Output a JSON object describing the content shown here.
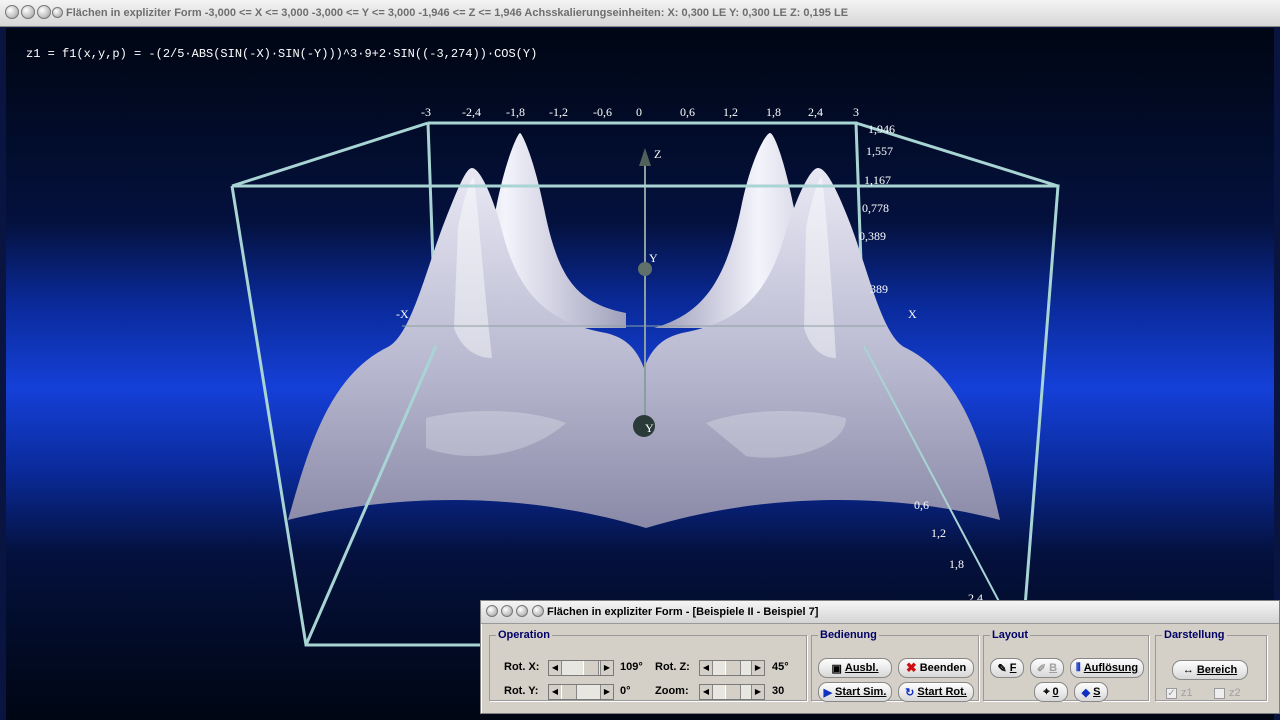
{
  "main_window": {
    "title": "Flächen in expliziter Form   -3,000 <= X <= 3,000   -3,000 <= Y <= 3,000   -1,946 <= Z <= 1,946   Achsskalierungseinheiten:  X: 0,300 LE    Y: 0,300 LE    Z: 0,195 LE"
  },
  "plot": {
    "formula": "z1 = f1(x,y,p) = -(2/5·ABS(SIN(-X)·SIN(-Y)))^3·9+2·SIN((-3,274))·COS(Y)",
    "x_ticks": [
      "-3",
      "-2,4",
      "-1,8",
      "-1,2",
      "-0,6",
      "0",
      "0,6",
      "1,2",
      "1,8",
      "2,4",
      "3"
    ],
    "z_ticks": [
      "1,946",
      "1,557",
      "1,167",
      "0,778",
      "0,389",
      "389"
    ],
    "y_ticks": [
      "0,6",
      "1,2",
      "1,8",
      "2,4"
    ],
    "axis_labels": {
      "z": "Z",
      "y_top": "Y",
      "y_bottom": "Y",
      "x_neg": "-X",
      "x_pos": "X"
    },
    "colors": {
      "surface": "#c4c4da",
      "frame": "#a8d4d4",
      "background": "#1540d8"
    }
  },
  "panel": {
    "title": "Flächen in expliziter Form - [Beispiele II - Beispiel 7]",
    "operation": {
      "legend": "Operation",
      "rot_x_label": "Rot. X:",
      "rot_x_value": "109°",
      "rot_y_label": "Rot. Y:",
      "rot_y_value": "0°",
      "rot_z_label": "Rot. Z:",
      "rot_z_value": "45°",
      "zoom_label": "Zoom:",
      "zoom_value": "30"
    },
    "bedienung": {
      "legend": "Bedienung",
      "ausbl": "Ausbl.",
      "beenden": "Beenden",
      "start_sim": "Start Sim.",
      "start_rot": "Start Rot."
    },
    "layout": {
      "legend": "Layout",
      "f": "F",
      "b": "B",
      "aufloesung": "Auflösung",
      "zero": "0",
      "s": "S"
    },
    "darstellung": {
      "legend": "Darstellung",
      "bereich": "Bereich",
      "z1": "z1",
      "z1_checked": true,
      "z2": "z2",
      "z2_checked": false
    }
  }
}
